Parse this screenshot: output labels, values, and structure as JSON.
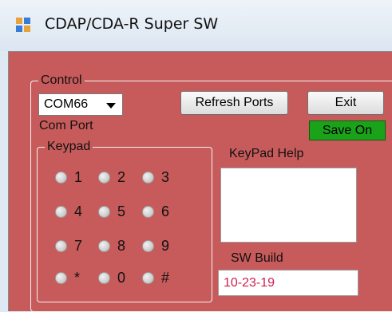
{
  "window": {
    "title": "CDAP/CDA-R Super SW"
  },
  "control_group": {
    "legend": "Control"
  },
  "com_port": {
    "selected": "COM66",
    "label": "Com Port"
  },
  "buttons": {
    "refresh": "Refresh Ports",
    "exit": "Exit"
  },
  "status": {
    "save": "Save On"
  },
  "keypad_group": {
    "legend": "Keypad"
  },
  "keypad": {
    "keys": [
      {
        "label": "1"
      },
      {
        "label": "2"
      },
      {
        "label": "3"
      },
      {
        "label": "4"
      },
      {
        "label": "5"
      },
      {
        "label": "6"
      },
      {
        "label": "7"
      },
      {
        "label": "8"
      },
      {
        "label": "9"
      },
      {
        "label": "*"
      },
      {
        "label": "0"
      },
      {
        "label": "#"
      }
    ]
  },
  "keypad_help": {
    "label": "KeyPad Help",
    "value": ""
  },
  "sw_build": {
    "label": "SW Build",
    "value": "10-23-19"
  },
  "colors": {
    "panel": "#c75b5b",
    "save_badge": "#1aa31a",
    "build_text": "#d01e4e"
  }
}
